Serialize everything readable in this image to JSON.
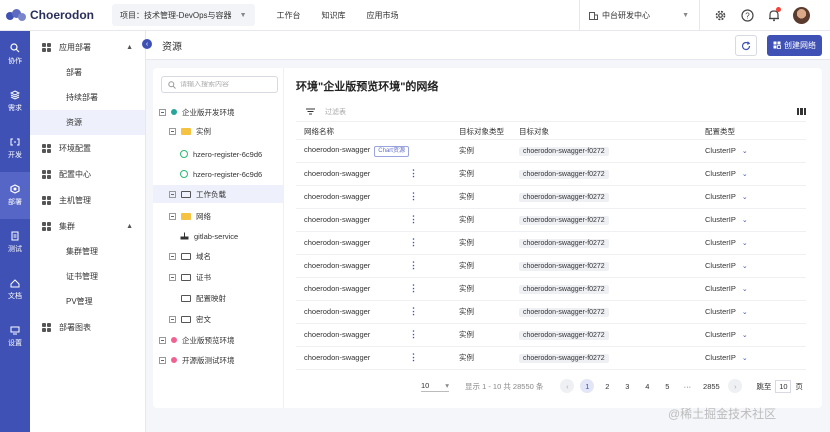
{
  "app": {
    "name": "Choerodon"
  },
  "topbar": {
    "project_label": "项目：技术管理-DevOps与容器",
    "nav": [
      "工作台",
      "知识库",
      "应用市场"
    ],
    "org_label": "中台研发中心"
  },
  "rail": {
    "items": [
      {
        "label": "协作",
        "icon": "collab-icon"
      },
      {
        "label": "需求",
        "icon": "requirement-icon"
      },
      {
        "label": "开发",
        "icon": "code-icon"
      },
      {
        "label": "部署",
        "icon": "deploy-icon"
      },
      {
        "label": "测试",
        "icon": "test-icon"
      },
      {
        "label": "文档",
        "icon": "doc-icon"
      },
      {
        "label": "设置",
        "icon": "settings-icon"
      }
    ]
  },
  "menu": {
    "app_deploy": "应用部署",
    "deploy": "部署",
    "continuous_deploy": "持续部署",
    "resources": "资源",
    "env_config": "环境配置",
    "config_center": "配置中心",
    "host_mgmt": "主机管理",
    "cluster": "集群",
    "cluster_mgmt": "集群管理",
    "cert_mgmt": "证书管理",
    "pv_mgmt": "PV管理",
    "deploy_chart": "部署图表"
  },
  "page": {
    "title": "资源",
    "create_label": "创建网络"
  },
  "tree": {
    "search_placeholder": "请输入搜索内容",
    "env1": "企业版开发环境",
    "instances": "实例",
    "inst1": "hzero-register-6c9d6",
    "inst2": "hzero-register-6c9d6",
    "workloads": "工作负载",
    "network": "网络",
    "svc": "gitlab-service",
    "domain": "域名",
    "certs": "证书",
    "config_map": "配置映射",
    "secret": "密文",
    "env2": "企业版预览环境",
    "env3": "开源版测试环境"
  },
  "net": {
    "heading": "环境\"企业版预览环境\"的网络",
    "filter_placeholder": "过滤表",
    "columns": [
      "网络名称",
      "目标对象类型",
      "目标对象",
      "配置类型"
    ],
    "chart_badge": "Chart资源",
    "rows": [
      {
        "name": "choerodon-swagger",
        "target_type": "实例",
        "target": "choerodon-swagger-f0272",
        "config": "ClusterIP"
      },
      {
        "name": "choerodon-swagger",
        "target_type": "实例",
        "target": "choerodon-swagger-f0272",
        "config": "ClusterIP"
      },
      {
        "name": "choerodon-swagger",
        "target_type": "实例",
        "target": "choerodon-swagger-f0272",
        "config": "ClusterIP"
      },
      {
        "name": "choerodon-swagger",
        "target_type": "实例",
        "target": "choerodon-swagger-f0272",
        "config": "ClusterIP"
      },
      {
        "name": "choerodon-swagger",
        "target_type": "实例",
        "target": "choerodon-swagger-f0272",
        "config": "ClusterIP"
      },
      {
        "name": "choerodon-swagger",
        "target_type": "实例",
        "target": "choerodon-swagger-f0272",
        "config": "ClusterIP"
      },
      {
        "name": "choerodon-swagger",
        "target_type": "实例",
        "target": "choerodon-swagger-f0272",
        "config": "ClusterIP"
      },
      {
        "name": "choerodon-swagger",
        "target_type": "实例",
        "target": "choerodon-swagger-f0272",
        "config": "ClusterIP"
      },
      {
        "name": "choerodon-swagger",
        "target_type": "实例",
        "target": "choerodon-swagger-f0272",
        "config": "ClusterIP"
      },
      {
        "name": "choerodon-swagger",
        "target_type": "实例",
        "target": "choerodon-swagger-f0272",
        "config": "ClusterIP"
      }
    ]
  },
  "pager": {
    "page_size": "10",
    "range_text": "显示 1 - 10 共 28550 条",
    "pages": [
      "1",
      "2",
      "3",
      "4",
      "5"
    ],
    "ellipsis": "···",
    "last": "2855",
    "jump_label": "跳至",
    "jump_value": "10",
    "page_suffix": "页"
  },
  "watermark": "@稀土掘金技术社区",
  "colors": {
    "primary": "#3f51b5",
    "success": "#2eb872",
    "env_dev": "#26a69a",
    "env_other": "#f06292"
  }
}
